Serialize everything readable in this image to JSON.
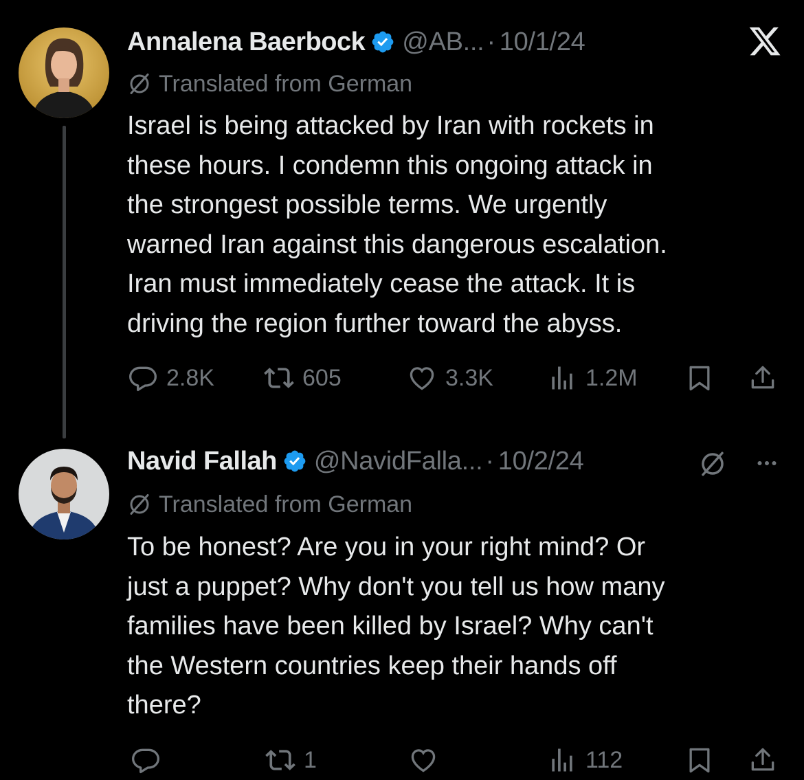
{
  "tweet1": {
    "name": "Annalena Baerbock",
    "handle": "@AB...",
    "separator": "·",
    "date": "10/1/24",
    "translated": "Translated from German",
    "lines": [
      "Israel is being attacked by Iran with rockets in",
      "these hours. I condemn this ongoing attack in",
      "the strongest possible terms. We urgently",
      "warned Iran against this dangerous escalation.",
      "Iran must immediately cease the attack. It is",
      "driving the region further toward the abyss."
    ],
    "replies": "2.8K",
    "reposts": "605",
    "likes": "3.3K",
    "views": "1.2M"
  },
  "tweet2": {
    "name": "Navid Fallah",
    "handle": "@NavidFalla...",
    "separator": "·",
    "date": "10/2/24",
    "translated": "Translated from German",
    "lines": [
      "To be honest? Are you in your right mind? Or",
      "just a puppet? Why don't you tell us how many",
      "families have been killed by Israel? Why can't",
      "the Western countries keep their hands off",
      "there?"
    ],
    "replies": "",
    "reposts": "1",
    "likes": "",
    "views": "112"
  },
  "icons": {
    "brand": "x-logo-icon",
    "translate": "translate-slash-icon",
    "reply": "reply-icon",
    "repost": "repost-icon",
    "like": "heart-icon",
    "views": "views-icon",
    "bookmark": "bookmark-icon",
    "share": "share-icon",
    "more": "more-icon"
  },
  "colors": {
    "background": "#000000",
    "text": "#e7e9ea",
    "secondary": "#71767b",
    "verified": "#1d9bf0",
    "thread_line": "#3a3d40"
  }
}
